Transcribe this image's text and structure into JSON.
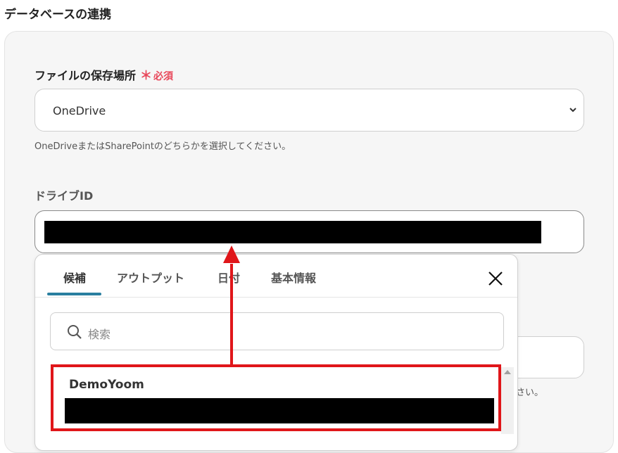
{
  "section": {
    "title": "データベースの連携"
  },
  "storage": {
    "label": "ファイルの保存場所",
    "required_star": "＊",
    "required_text": "必須",
    "selected": "OneDrive",
    "help": "OneDriveまたはSharePointのどちらかを選択してください。"
  },
  "drive": {
    "label": "ドライブID",
    "value_redacted": true
  },
  "hidden_field": {
    "help_fragment": "さい。"
  },
  "popover": {
    "tabs": [
      {
        "label": "候補",
        "active": true
      },
      {
        "label": "アウトプット"
      },
      {
        "label": "日付"
      },
      {
        "label": "基本情報"
      }
    ],
    "search": {
      "placeholder": "検索"
    },
    "options": [
      {
        "title": "DemoYoom",
        "subtitle_redacted": true
      }
    ]
  },
  "icons": {
    "chevron": "chevron-down-icon",
    "close": "close-icon",
    "search": "search-icon"
  },
  "colors": {
    "required": "#e8475a",
    "tab_active": "#2a7fa0",
    "annotation_red": "#e0161a"
  }
}
